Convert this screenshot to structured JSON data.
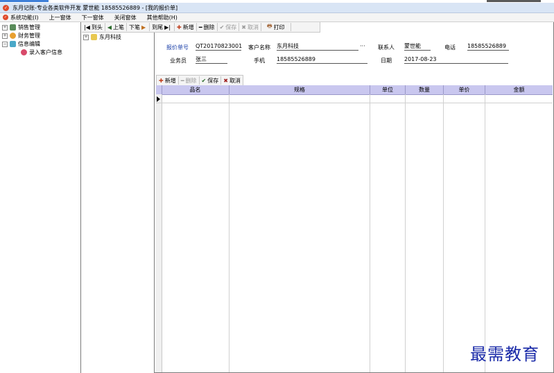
{
  "window": {
    "title": "东月记账-专业各类软件开发 蒙世能 18585526889 - [我的报价单]"
  },
  "menu": {
    "items": [
      "系统功能(I)",
      "上一窗体",
      "下一窗体",
      "关闭窗体",
      "其他帮助(H)"
    ]
  },
  "tree": {
    "sales": "销售管理",
    "finance": "财务管理",
    "info": "信息编辑",
    "entry": "录入客户信息"
  },
  "mid_tree": {
    "company": "东月科技"
  },
  "nav_toolbar": {
    "first": "到头",
    "prev": "上笔",
    "next": "下笔",
    "last": "到尾",
    "add": "新增",
    "delete": "删除",
    "save": "保存",
    "cancel": "取消",
    "print": "打印"
  },
  "form": {
    "quote_no_label": "报价单号",
    "quote_no": "QT20170823001",
    "customer_label": "客户名称",
    "customer": "东月科技",
    "ellipsis": "···",
    "contact_label": "联系人",
    "contact": "蒙世能",
    "phone_label": "电话",
    "phone": "18585526889",
    "salesman_label": "业务员",
    "salesman": "张三",
    "mobile_label": "手机",
    "mobile": "18585526889",
    "date_label": "日期",
    "date": "2017-08-23"
  },
  "grid_toolbar": {
    "add": "新增",
    "delete": "删除",
    "save": "保存",
    "cancel": "取消"
  },
  "grid": {
    "columns": [
      "品名",
      "规格",
      "单位",
      "数量",
      "单价",
      "金额"
    ]
  },
  "watermark": "最需教育",
  "colors": {
    "header_bg": "#c9c7ef",
    "title_bg": "#d9e5f5",
    "watermark": "#1a2aa8"
  }
}
